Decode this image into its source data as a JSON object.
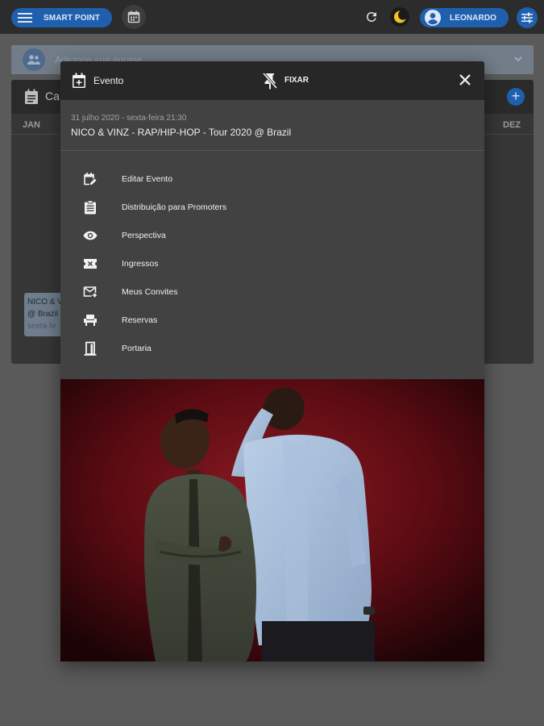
{
  "topbar": {
    "brand_label": "SMART POINT",
    "user_label": "LEONARDO",
    "icons": [
      "menu-icon",
      "calendar-icon",
      "refresh-icon",
      "moon-icon",
      "account-icon",
      "tune-icon"
    ]
  },
  "background": {
    "team_placeholder": "Adicione sua equipe",
    "calendar_title": "Ca",
    "months": {
      "first": "JAN",
      "last": "DEZ"
    },
    "event_chip": {
      "line1": "NICO & V",
      "line2": "@ Brazil",
      "line3": "sexta-fe"
    }
  },
  "modal": {
    "title": "Evento",
    "pin_label": "FIXAR",
    "event_date": "31 julho 2020 - sexta-feira 21:30",
    "event_title": "NICO & VINZ - RAP/HIP-HOP - Tour 2020 @ Brazil",
    "menu": [
      {
        "label": "Editar Evento",
        "icon": "edit-calendar-icon"
      },
      {
        "label": "Distribuição para Promoters",
        "icon": "clipboard-list-icon"
      },
      {
        "label": "Perspectiva",
        "icon": "eye-icon"
      },
      {
        "label": "Ingressos",
        "icon": "ticket-icon"
      },
      {
        "label": "Meus Convites",
        "icon": "mail-forward-icon"
      },
      {
        "label": "Reservas",
        "icon": "chair-icon"
      },
      {
        "label": "Portaria",
        "icon": "door-icon"
      }
    ]
  },
  "colors": {
    "accent": "#1e5fae",
    "topbar": "#2c2c2c",
    "modal_bg": "#424242",
    "modal_header": "#272727",
    "photo_backdrop": "#6a0f16"
  }
}
